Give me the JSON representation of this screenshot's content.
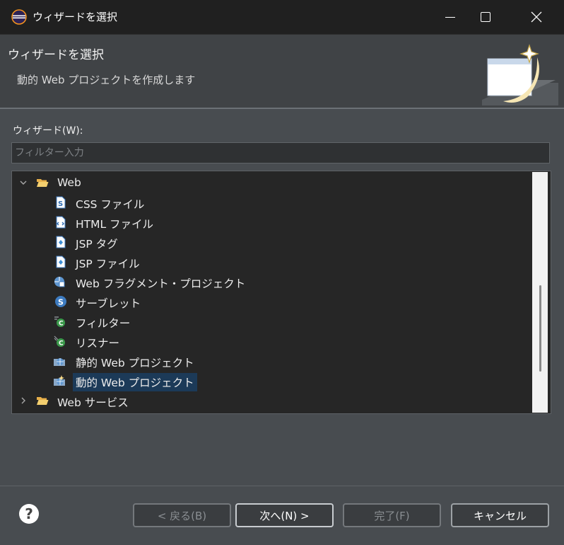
{
  "window": {
    "title": "ウィザードを選択"
  },
  "banner": {
    "title": "ウィザードを選択",
    "description": "動的 Web プロジェクトを作成します"
  },
  "wizards": {
    "label": "ウィザード(W):",
    "filter_placeholder": "フィルター入力",
    "filter_value": ""
  },
  "tree": {
    "web": {
      "label": "Web",
      "expanded": true,
      "children": [
        {
          "label": "CSS ファイル",
          "icon": "css-file-icon"
        },
        {
          "label": "HTML ファイル",
          "icon": "html-file-icon"
        },
        {
          "label": "JSP タグ",
          "icon": "jsp-tag-icon"
        },
        {
          "label": "JSP ファイル",
          "icon": "jsp-file-icon"
        },
        {
          "label": "Web フラグメント・プロジェクト",
          "icon": "web-fragment-project-icon"
        },
        {
          "label": "サーブレット",
          "icon": "servlet-icon"
        },
        {
          "label": "フィルター",
          "icon": "filter-icon"
        },
        {
          "label": "リスナー",
          "icon": "listener-icon"
        },
        {
          "label": "静的 Web プロジェクト",
          "icon": "static-web-project-icon"
        },
        {
          "label": "動的 Web プロジェクト",
          "icon": "dynamic-web-project-icon",
          "selected": true
        }
      ]
    },
    "web_services": {
      "label": "Web サービス",
      "expanded": false
    }
  },
  "buttons": {
    "back": "< 戻る(B)",
    "next": "次へ(N) >",
    "finish": "完了(F)",
    "cancel": "キャンセル",
    "help": "?"
  },
  "colors": {
    "selection": "#1c3a58",
    "background": "#484c50",
    "tree_background": "#262626"
  }
}
